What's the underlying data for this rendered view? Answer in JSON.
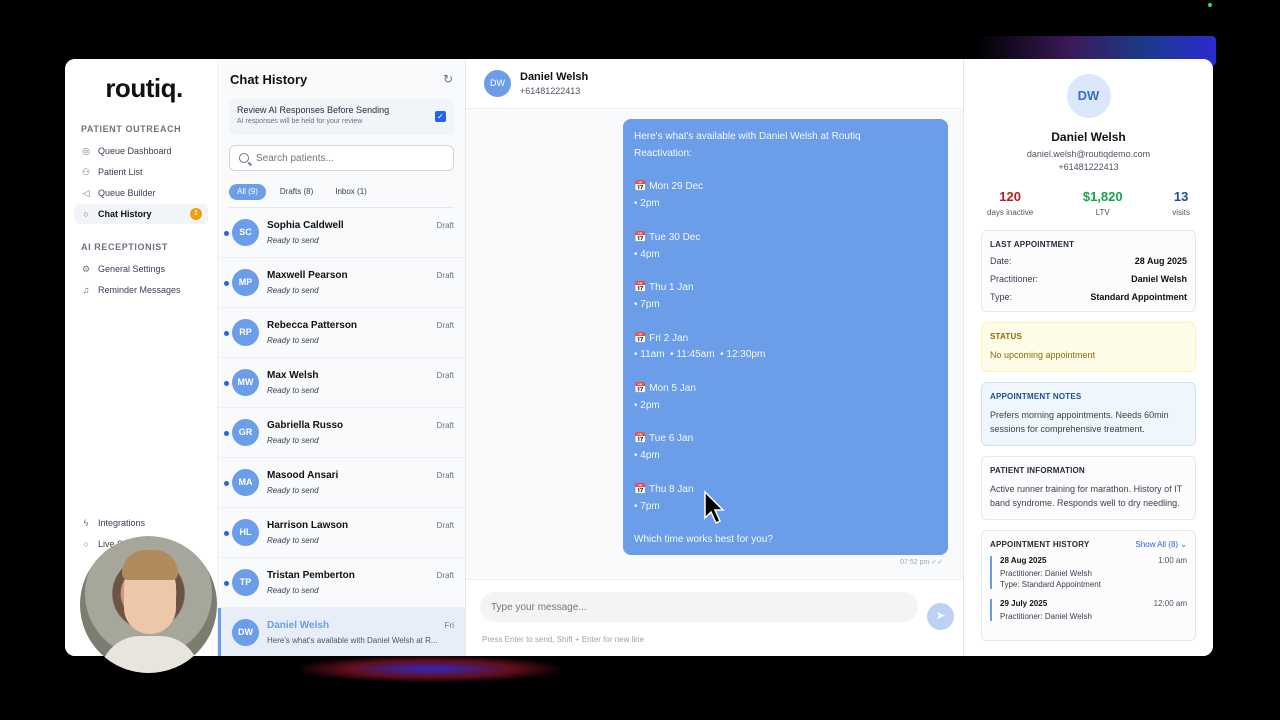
{
  "app": {
    "logo": "routiq.",
    "colors": {
      "accent": "#6b9de8",
      "primary": "#2563eb",
      "danger": "#b91c1c",
      "success": "#16a34a",
      "badge": "#f59e0b"
    }
  },
  "sidebar": {
    "section1": "PATIENT OUTREACH",
    "items1": [
      {
        "label": "Queue Dashboard",
        "icon": "target-icon"
      },
      {
        "label": "Patient List",
        "icon": "users-icon"
      },
      {
        "label": "Queue Builder",
        "icon": "megaphone-icon"
      },
      {
        "label": "Chat History",
        "icon": "chat-icon",
        "badge": "1"
      }
    ],
    "section2": "AI RECEPTIONIST",
    "items2": [
      {
        "label": "General Settings",
        "icon": "gear-icon"
      },
      {
        "label": "Reminder Messages",
        "icon": "bell-icon"
      }
    ],
    "bottom": [
      {
        "label": "Integrations",
        "icon": "bolt-icon"
      },
      {
        "label": "Live S",
        "icon": "chat-icon"
      }
    ]
  },
  "chatlist": {
    "title": "Chat History",
    "review": {
      "title": "Review AI Responses Before Sending",
      "subtitle": "AI responses will be held for your review",
      "checked": true
    },
    "search_placeholder": "Search patients...",
    "filters": [
      "All (9)",
      "Drafts (8)",
      "Inbox (1)"
    ],
    "conversations": [
      {
        "initials": "SC",
        "name": "Sophia Caldwell",
        "sub": "Ready to send",
        "tag": "Draft"
      },
      {
        "initials": "MP",
        "name": "Maxwell Pearson",
        "sub": "Ready to send",
        "tag": "Draft"
      },
      {
        "initials": "RP",
        "name": "Rebecca Patterson",
        "sub": "Ready to send",
        "tag": "Draft"
      },
      {
        "initials": "MW",
        "name": "Max Welsh",
        "sub": "Ready to send",
        "tag": "Draft"
      },
      {
        "initials": "GR",
        "name": "Gabriella Russo",
        "sub": "Ready to send",
        "tag": "Draft"
      },
      {
        "initials": "MA",
        "name": "Masood Ansari",
        "sub": "Ready to send",
        "tag": "Draft"
      },
      {
        "initials": "HL",
        "name": "Harrison Lawson",
        "sub": "Ready to send",
        "tag": "Draft"
      },
      {
        "initials": "TP",
        "name": "Tristan Pemberton",
        "sub": "Ready to send",
        "tag": "Draft"
      },
      {
        "initials": "DW",
        "name": "Daniel Welsh",
        "sub": "Here's what's available with Daniel Welsh at R...",
        "tag": "Fri"
      }
    ]
  },
  "chat": {
    "initials": "DW",
    "name": "Daniel Welsh",
    "phone": "+61481222413",
    "message_lines": [
      "Here's what's available with Daniel Welsh at Routiq",
      "Reactivation:",
      "",
      "📅 Mon 29 Dec",
      "• 2pm",
      "",
      "📅 Tue 30 Dec",
      "• 4pm",
      "",
      "📅 Thu 1 Jan",
      "• 7pm",
      "",
      "📅 Fri 2 Jan",
      "• 11am  • 11:45am  • 12:30pm",
      "",
      "📅 Mon 5 Jan",
      "• 2pm",
      "",
      "📅 Tue 6 Jan",
      "• 4pm",
      "",
      "📅 Thu 8 Jan",
      "• 7pm",
      "",
      "Which time works best for you?"
    ],
    "time": "07:52 pm ✓✓",
    "input_placeholder": "Type your message...",
    "hint": "Press Enter to send, Shift + Enter for new line"
  },
  "profile": {
    "initials": "DW",
    "name": "Daniel Welsh",
    "email": "daniel.welsh@routiqdemo.com",
    "phone": "+61481222413",
    "stats": [
      {
        "value": "120",
        "label": "days inactive",
        "color": "#b91c1c"
      },
      {
        "value": "$1,820",
        "label": "LTV",
        "color": "#16a34a"
      },
      {
        "value": "13",
        "label": "visits",
        "color": "#1d4f91"
      }
    ],
    "last_appointment": {
      "title": "LAST APPOINTMENT",
      "date_label": "Date:",
      "date": "28 Aug 2025",
      "practitioner_label": "Practitioner:",
      "practitioner": "Daniel Welsh",
      "type_label": "Type:",
      "type": "Standard Appointment"
    },
    "status": {
      "title": "STATUS",
      "text": "No upcoming appointment"
    },
    "notes": {
      "title": "APPOINTMENT NOTES",
      "text": "Prefers morning appointments. Needs 60min sessions for comprehensive treatment."
    },
    "info": {
      "title": "PATIENT INFORMATION",
      "text": "Active runner training for marathon. History of IT band syndrome. Responds well to dry needling."
    },
    "history": {
      "title": "APPOINTMENT HISTORY",
      "show_all": "Show All (8) ⌄",
      "items": [
        {
          "date": "28 Aug 2025",
          "time": "1:00 am",
          "practitioner": "Practitioner: Daniel Welsh",
          "type": "Type: Standard Appointment"
        },
        {
          "date": "29 July 2025",
          "time": "12:00 am",
          "practitioner": "Practitioner: Daniel Welsh",
          "type": ""
        }
      ]
    }
  }
}
